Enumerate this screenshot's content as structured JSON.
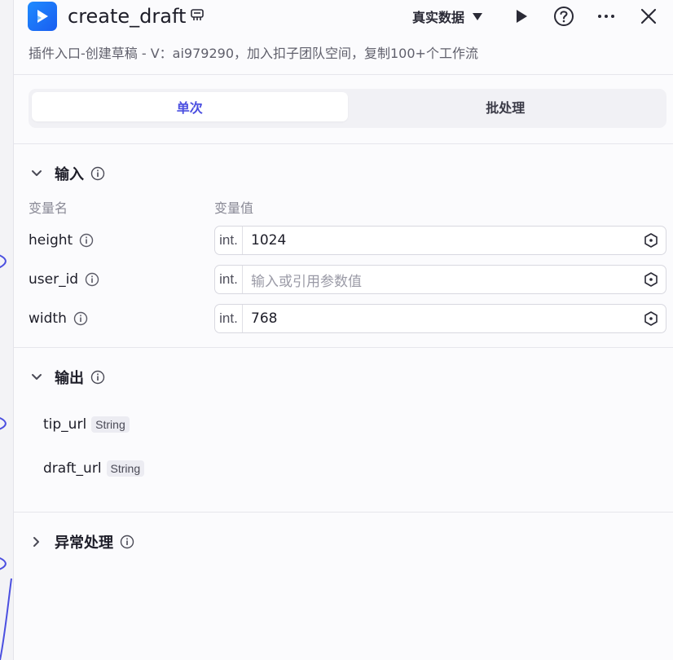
{
  "header": {
    "title": "create_draft",
    "subtitle": "插件入口-创建草稿 - V：ai979290，加入扣子团队空间，复制100+个工作流",
    "data_mode": "真实数据"
  },
  "tabs": [
    {
      "label": "单次",
      "active": true
    },
    {
      "label": "批处理",
      "active": false
    }
  ],
  "input": {
    "title": "输入",
    "col_name": "变量名",
    "col_value": "变量值",
    "fields": [
      {
        "name": "height",
        "type": "int.",
        "value": "1024",
        "placeholder": ""
      },
      {
        "name": "user_id",
        "type": "int.",
        "value": "",
        "placeholder": "输入或引用参数值"
      },
      {
        "name": "width",
        "type": "int.",
        "value": "768",
        "placeholder": ""
      }
    ]
  },
  "output": {
    "title": "输出",
    "fields": [
      {
        "name": "tip_url",
        "type": "String"
      },
      {
        "name": "draft_url",
        "type": "String"
      }
    ]
  },
  "exception": {
    "title": "异常处理"
  },
  "colors": {
    "accent": "#4b4fe0",
    "logo": "#1a6ff5",
    "border": "#d8d8e0"
  }
}
